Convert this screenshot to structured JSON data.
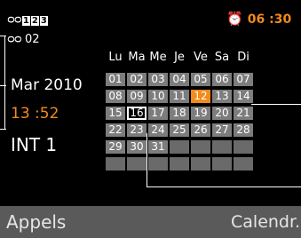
{
  "status": {
    "voicemail_icon": "voicemail-icon",
    "badges": [
      "1",
      "2",
      "3"
    ],
    "line2_icon": "voicemail-icon",
    "line2_text": "02",
    "alarm_icon": "alarm-clock-icon",
    "alarm_time": "06 :30"
  },
  "left": {
    "month": "Mar 2010",
    "time": "13 :52",
    "line": "INT 1"
  },
  "calendar": {
    "weekdays": [
      "Lu",
      "Ma",
      "Me",
      "Je",
      "Ve",
      "Sa",
      "Di"
    ],
    "rows": [
      [
        "01",
        "02",
        "03",
        "04",
        "05",
        "06",
        "07"
      ],
      [
        "08",
        "09",
        "10",
        "11",
        "12",
        "13",
        "14"
      ],
      [
        "15",
        "16",
        "17",
        "18",
        "19",
        "20",
        "21"
      ],
      [
        "22",
        "23",
        "24",
        "25",
        "26",
        "27",
        "28"
      ],
      [
        "29",
        "30",
        "31",
        "",
        "",
        "",
        ""
      ],
      [
        "",
        "",
        "",
        "",
        "",
        "",
        ""
      ]
    ],
    "today": "12",
    "selected": "16"
  },
  "softkeys": {
    "left": "Appels",
    "right": "Calendr."
  },
  "colors": {
    "accent": "#f28a1c",
    "cell": "#7d7d7d",
    "bar": "#5a5a5a"
  }
}
